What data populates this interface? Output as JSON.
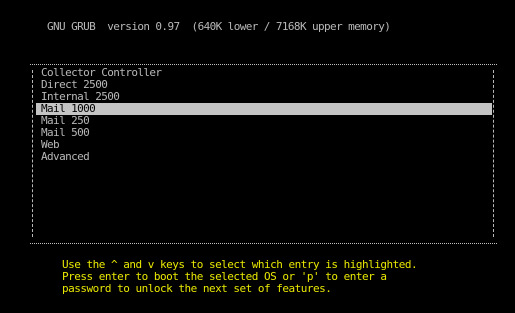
{
  "header": {
    "title": "GNU GRUB  version 0.97  (640K lower / 7168K upper memory)"
  },
  "menu": {
    "entries": [
      {
        "label": "Collector Controller",
        "selected": false
      },
      {
        "label": "Direct 2500",
        "selected": false
      },
      {
        "label": "Internal 2500",
        "selected": false
      },
      {
        "label": "Mail 1000",
        "selected": true
      },
      {
        "label": "Mail 250",
        "selected": false
      },
      {
        "label": "Mail 500",
        "selected": false
      },
      {
        "label": "Web",
        "selected": false
      },
      {
        "label": "Advanced",
        "selected": false
      }
    ]
  },
  "help": {
    "lines": [
      "Use the ^ and v keys to select which entry is highlighted.",
      "Press enter to boot the selected OS or 'p' to enter a",
      "password to unlock the next set of features."
    ]
  },
  "colors": {
    "background": "#000000",
    "text": "#b8b8b8",
    "highlight_bg": "#c4c4c4",
    "highlight_text": "#000000",
    "help_text": "#e8e800"
  }
}
